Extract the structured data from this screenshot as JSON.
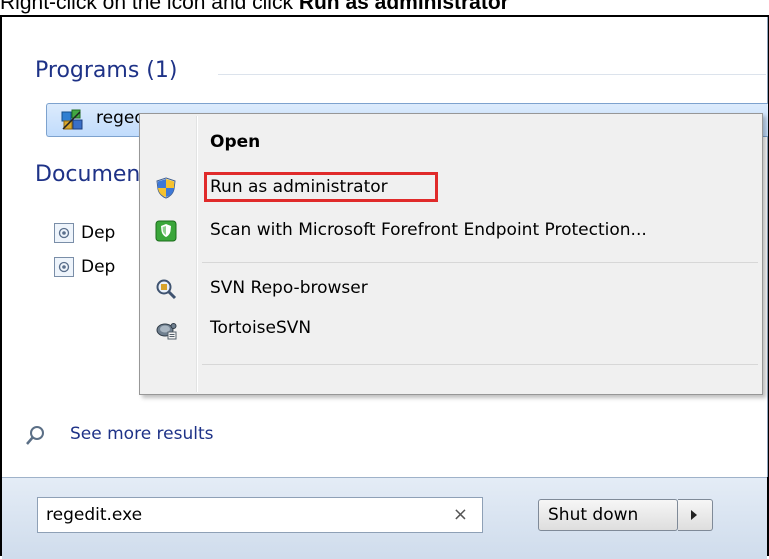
{
  "caption": {
    "prefix": "Right-click on the icon and click ",
    "bold": "Run as administrator"
  },
  "start_menu": {
    "programs_header": "Programs (1)",
    "program_result": {
      "label": "regedit",
      "icon": "regedit-icon"
    },
    "documents_header": "Documents",
    "document_results": [
      {
        "label": "Dep",
        "icon": "document-icon"
      },
      {
        "label": "Dep",
        "icon": "document-icon"
      }
    ],
    "see_more": {
      "label": "See more results",
      "icon": "search-icon"
    },
    "search": {
      "value": "regedit.exe",
      "clear_glyph": "×"
    },
    "shutdown": {
      "label": "Shut down",
      "icon": "arrow-right-icon"
    }
  },
  "context_menu": {
    "items": [
      {
        "label": "Open",
        "bold": true,
        "icon": ""
      },
      {
        "label": "Run as administrator",
        "icon": "uac-shield-icon",
        "highlight_color": "#e02a2a"
      },
      {
        "label": "Scan with Microsoft Forefront Endpoint Protection...",
        "icon": "forefront-icon"
      },
      {
        "label": "SVN Repo-browser",
        "icon": "svn-repo-browser-icon"
      },
      {
        "label": "TortoiseSVN",
        "icon": "tortoisesvn-icon"
      }
    ]
  },
  "colors": {
    "section_title": "#1e3287",
    "selection_bg": "#c9e0fc",
    "menu_bg": "#f0f0f0"
  }
}
